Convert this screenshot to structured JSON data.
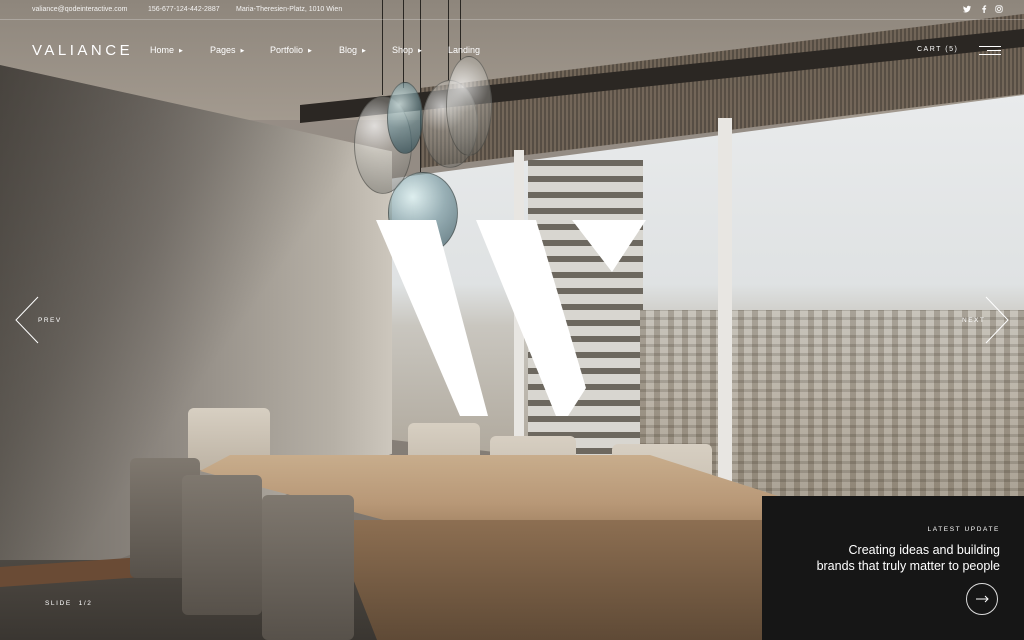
{
  "topbar": {
    "email": "valiance@qodeinteractive.com",
    "phone": "156-677-124-442-2887",
    "address": "Maria-Theresien-Platz, 1010 Wien",
    "social": [
      "twitter-icon",
      "facebook-icon",
      "instagram-icon"
    ]
  },
  "header": {
    "logo": "VALIANCE",
    "nav": [
      {
        "label": "Home",
        "has_dropdown": true
      },
      {
        "label": "Pages",
        "has_dropdown": true
      },
      {
        "label": "Portfolio",
        "has_dropdown": true
      },
      {
        "label": "Blog",
        "has_dropdown": true
      },
      {
        "label": "Shop",
        "has_dropdown": true
      },
      {
        "label": "Landing",
        "has_dropdown": false
      }
    ],
    "cart_label": "CART (5)"
  },
  "slider": {
    "prev_label": "PREV",
    "next_label": "NEXT",
    "slide_counter": "SLIDE  1/2",
    "logo_mark_icon": "v-logo-mark"
  },
  "latest_update": {
    "label": "LATEST UPDATE",
    "line1": "Creating ideas and building",
    "line2": "brands that truly matter to people",
    "button_icon": "arrow-right-icon"
  },
  "colors": {
    "panel": "#161616",
    "text": "#ffffff"
  }
}
